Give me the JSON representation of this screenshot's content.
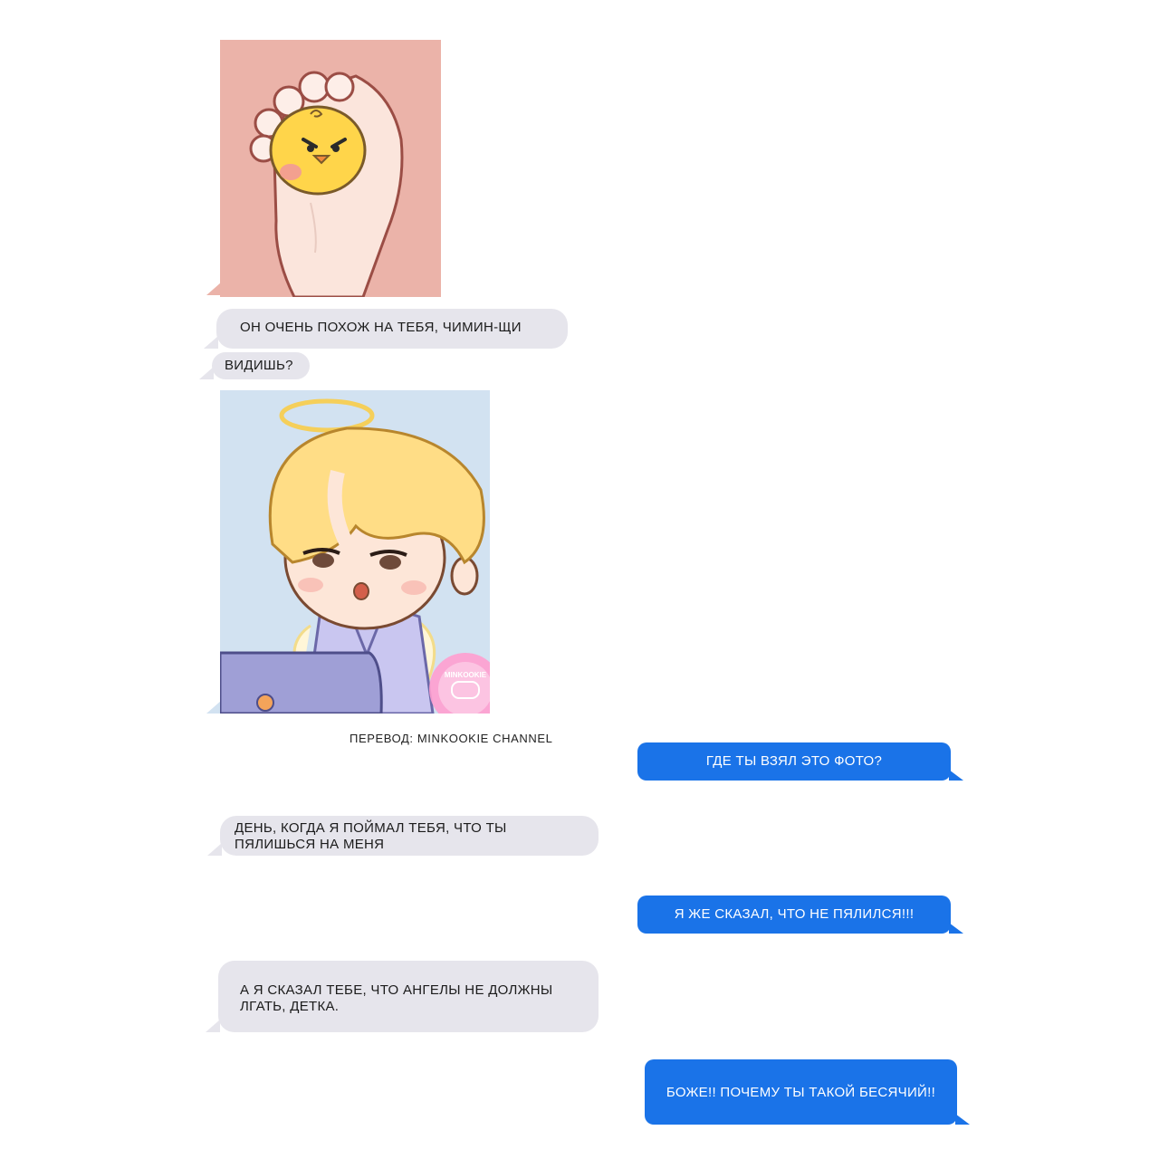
{
  "messages": {
    "m1": "ОН ОЧЕНЬ ПОХОЖ НА ТЕБЯ, ЧИМИН-ЩИ",
    "m2": "ВИДИШЬ?",
    "m3": "ГДЕ ТЫ ВЗЯЛ ЭТО ФОТО?",
    "m4": "ДЕНЬ, КОГДА Я ПОЙМАЛ ТЕБЯ, ЧТО ТЫ ПЯЛИШЬСЯ НА МЕНЯ",
    "m5": "Я ЖЕ СКАЗАЛ, ЧТО НЕ ПЯЛИЛСЯ!!!",
    "m6": "А Я СКАЗАЛ ТЕБЕ, ЧТО АНГЕЛЫ НЕ ДОЛЖНЫ ЛГАТЬ, ДЕТКА.",
    "m7": "БОЖЕ!! ПОЧЕМУ ТЫ ТАКОЙ БЕСЯЧИЙ!!"
  },
  "credit": "ПЕРЕВОД: MINKOOKIE CHANNEL",
  "watermark": "MINKOOKIE",
  "colors": {
    "incoming_bubble": "#e6e5ec",
    "outgoing_bubble": "#1a73e8",
    "photo1_bg": "#ebb3a9",
    "photo2_bg": "#d2e2f1"
  },
  "icons": [
    "chick-hand-illustration",
    "angel-boy-illustration",
    "gamepad-icon"
  ]
}
